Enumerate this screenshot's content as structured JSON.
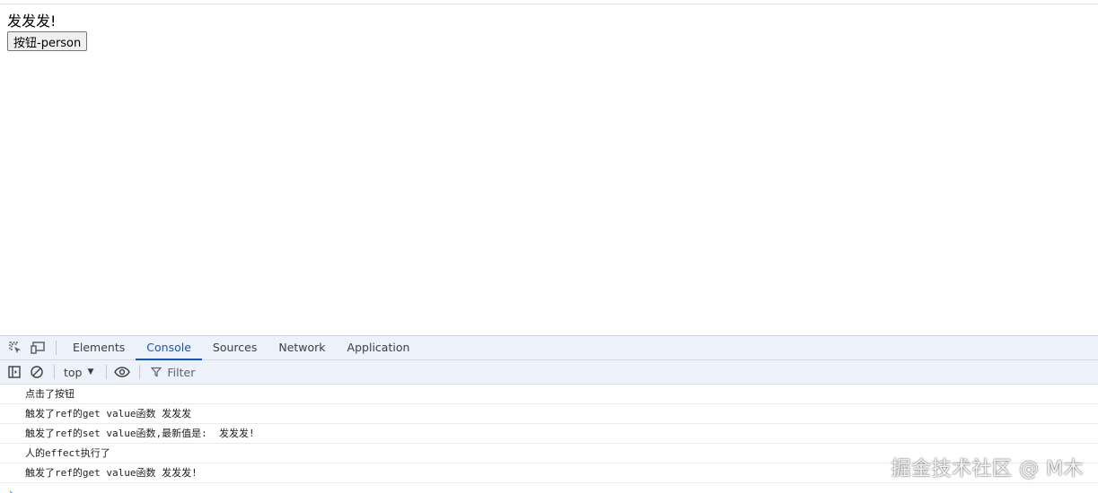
{
  "page": {
    "text": "发发发!",
    "button_label": "按钮-person"
  },
  "devtools": {
    "tabs": [
      {
        "label": "Elements"
      },
      {
        "label": "Console",
        "active": true
      },
      {
        "label": "Sources"
      },
      {
        "label": "Network"
      },
      {
        "label": "Application"
      }
    ],
    "toolbar": {
      "context": "top",
      "filter_label": "Filter"
    },
    "console_lines": [
      "点击了按钮",
      "触发了ref的get value函数 发发发",
      "触发了ref的set value函数,最新值是:  发发发!",
      "人的effect执行了",
      "触发了ref的get value函数 发发发!"
    ],
    "prompt_symbol": "›"
  },
  "watermark": "掘金技术社区 @ M木",
  "colors": {
    "accent": "#0b57d0",
    "devtools_bg": "#edf2fa"
  }
}
